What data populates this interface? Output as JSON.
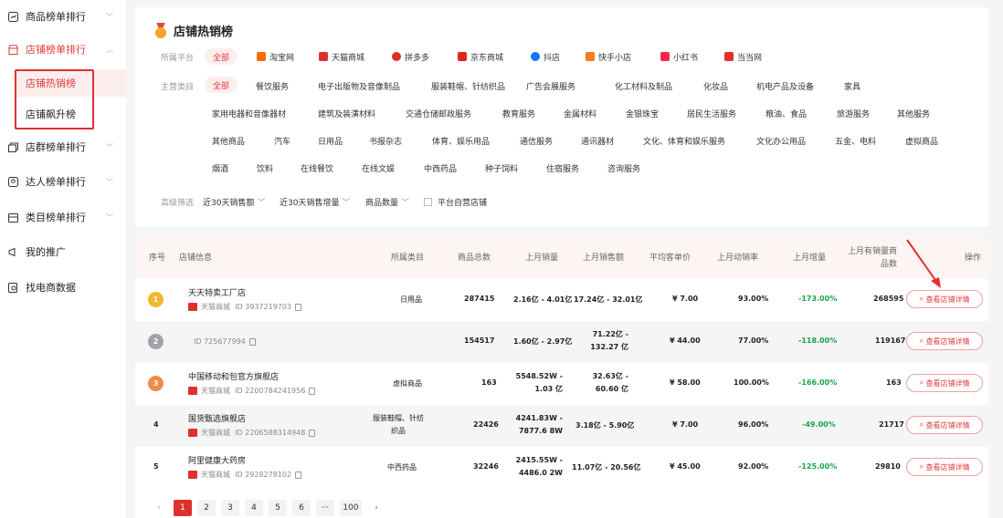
{
  "sidebar": {
    "items": [
      {
        "label": "商品榜单排行",
        "icon": "chart-square-icon"
      },
      {
        "label": "店铺榜单排行",
        "icon": "shop-icon"
      },
      {
        "label": "店群榜单排行",
        "icon": "stores-icon"
      },
      {
        "label": "达人榜单排行",
        "icon": "person-icon"
      },
      {
        "label": "类目榜单排行",
        "icon": "category-icon"
      },
      {
        "label": "我的推广",
        "icon": "megaphone-icon"
      },
      {
        "label": "找电商数据",
        "icon": "search-data-icon"
      }
    ],
    "subitems": [
      {
        "label": "店铺热销榜"
      },
      {
        "label": "店铺飙升榜"
      }
    ]
  },
  "filters": {
    "title": "店铺热销榜",
    "platform_label": "所属平台",
    "platforms": [
      "全部",
      "淘宝网",
      "天猫商城",
      "拼多多",
      "京东商城",
      "抖店",
      "快手小店",
      "小红书",
      "当当网"
    ],
    "category_label": "主营类目",
    "categories": [
      [
        "全部",
        "餐饮服务",
        "电子出版物及音像制品",
        "服装鞋帽、针纺织品",
        "广告会展服务",
        "化工材料及制品",
        "化妆品",
        "机电产品及设备",
        "家具"
      ],
      [
        "家用电器和音像器材",
        "建筑及装潢材料",
        "交通仓储邮政服务",
        "教育服务",
        "金属材料",
        "金银珠宝",
        "居民生活服务",
        "粮油、食品",
        "旅游服务",
        "其他服务"
      ],
      [
        "其他商品",
        "汽车",
        "日用品",
        "书报杂志",
        "体育、娱乐用品",
        "通信服务",
        "通讯器材",
        "文化、体育和娱乐服务",
        "文化办公用品",
        "五金、电料",
        "虚拟商品"
      ],
      [
        "烟酒",
        "饮料",
        "在线餐饮",
        "在线文娱",
        "中西药品",
        "种子饲料",
        "住宿服务",
        "咨询服务"
      ]
    ],
    "advanced_label": "高级筛选",
    "advanced": [
      "近30天销售额",
      "近30天销售增量",
      "商品数量",
      "平台自营店铺"
    ]
  },
  "table": {
    "headers": [
      "序号",
      "店铺信息",
      "所属类目",
      "商品总数",
      "上月销量",
      "上月销售额",
      "平均客单价",
      "上月动销率",
      "上月增量",
      "上月有销量商品数",
      "操作"
    ],
    "rows": [
      {
        "rank": "1",
        "name": "天天特卖工厂店",
        "platform": "天猫商城",
        "id": "ID 3937219703",
        "category": "日用品",
        "total": "287415",
        "sales": "2.16亿 - 4.01亿",
        "revenue": "17.24亿 - 32.01亿",
        "avg": "¥ 7.00",
        "rate": "93.00%",
        "growth": "-173.00%",
        "sold_items": "268595",
        "action": "查看店铺详情"
      },
      {
        "rank": "2",
        "name": "",
        "platform": "",
        "id": "ID 725677994",
        "category": "",
        "total": "154517",
        "sales": "1.60亿 - 2.97亿",
        "revenue": "71.22亿 - 132.27 亿",
        "avg": "¥ 44.00",
        "rate": "77.00%",
        "growth": "-118.00%",
        "sold_items": "119167",
        "action": "查看店铺详情"
      },
      {
        "rank": "3",
        "name": "中国移动和包官方旗舰店",
        "platform": "天猫商城",
        "id": "ID 2200784241956",
        "category": "虚拟商品",
        "total": "163",
        "sales": "5548.52W - 1.03 亿",
        "revenue": "32.63亿 - 60.60 亿",
        "avg": "¥ 58.00",
        "rate": "100.00%",
        "growth": "-166.00%",
        "sold_items": "163",
        "action": "查看店铺详情"
      },
      {
        "rank": "4",
        "name": "国货甄选旗舰店",
        "platform": "天猫商城",
        "id": "ID 2206588314948",
        "category": "服装鞋帽、针纺织品",
        "total": "22426",
        "sales": "4241.83W - 7877.6 8W",
        "revenue": "3.18亿 - 5.90亿",
        "avg": "¥ 7.00",
        "rate": "96.00%",
        "growth": "-49.00%",
        "sold_items": "21717",
        "action": "查看店铺详情"
      },
      {
        "rank": "5",
        "name": "阿里健康大药房",
        "platform": "天猫商城",
        "id": "ID 2928278102",
        "category": "中西药品",
        "total": "32246",
        "sales": "2415.55W - 4486.0 2W",
        "revenue": "11.07亿 - 20.56亿",
        "avg": "¥ 45.00",
        "rate": "92.00%",
        "growth": "-125.00%",
        "sold_items": "29810",
        "action": "查看店铺详情"
      }
    ]
  },
  "pagination": {
    "prev": "‹",
    "pages": [
      "1",
      "2",
      "3",
      "4",
      "5",
      "6",
      "···",
      "100"
    ],
    "next": "›"
  },
  "colors": {
    "accent": "#e0302e",
    "negative": "#1aa34a",
    "rank1": "#f5b731",
    "rank2": "#a0a4aa",
    "rank3": "#f08a4b"
  }
}
